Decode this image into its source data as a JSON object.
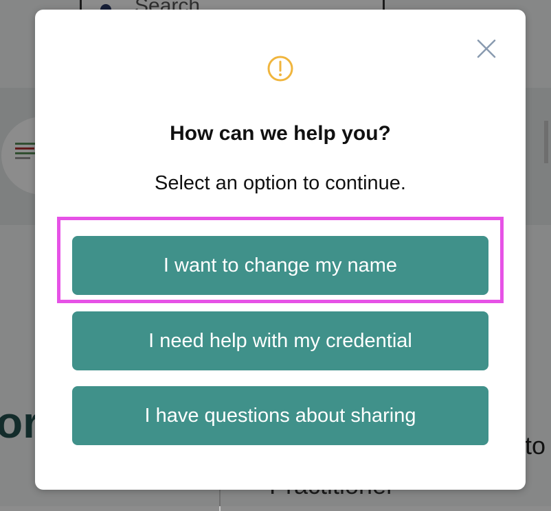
{
  "background": {
    "search_placeholder": "Search",
    "partial_heading": "or",
    "partial_text_right": "to",
    "partial_text_bottom": "Practitioner"
  },
  "modal": {
    "close_icon": "close-icon",
    "status_icon": "warning-circle-icon",
    "title": "How can we help you?",
    "subtitle": "Select an option to continue.",
    "options": [
      {
        "label": "I want to change my name",
        "highlighted": true
      },
      {
        "label": "I need help with my credential",
        "highlighted": false
      },
      {
        "label": "I have questions about sharing",
        "highlighted": false
      }
    ]
  },
  "colors": {
    "button_bg": "#40918a",
    "button_text": "#ffffff",
    "warning_icon": "#f0b53d",
    "highlight_border": "#e652e6",
    "close_icon": "#8a9bb0"
  }
}
